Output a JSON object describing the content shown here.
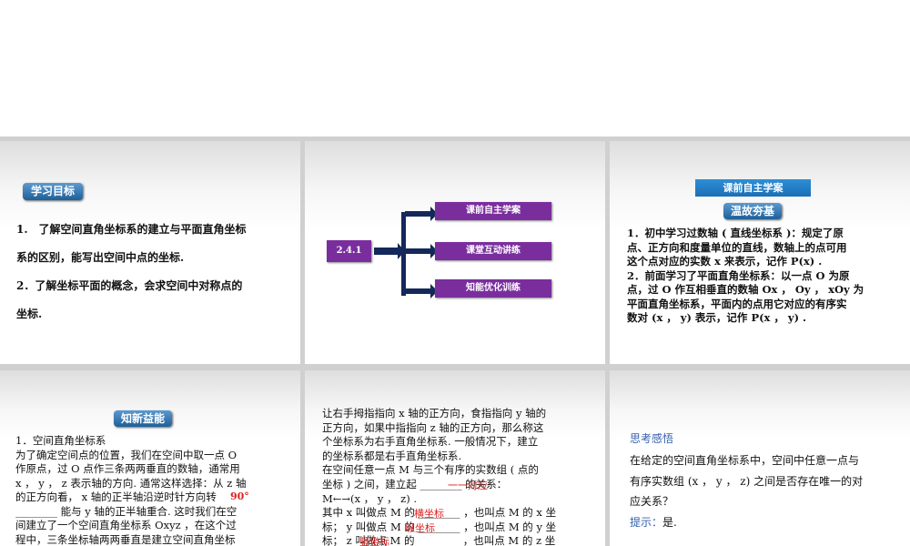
{
  "slide1": {
    "badge": "学习目标",
    "lines": [
      "1.　了解空间直角坐标系的建立与平面直角坐标",
      "系的区别，能写出空间中点的坐标.",
      "2．了解坐标平面的概念，会求空间中对称点的",
      "坐标."
    ]
  },
  "slide2": {
    "section": "2.4.1",
    "items": [
      "课前自主学案",
      "课堂互动讲练",
      "知能优化训练"
    ],
    "colors": {
      "box": "#7a2e9e",
      "arrow": "#14285a"
    }
  },
  "slide3": {
    "header": "课前自主学案",
    "badge": "温故夯基",
    "lines": [
      "1．初中学习过数轴 ( 直线坐标系 )：规定了原",
      "点、正方向和度量单位的直线，数轴上的点可用",
      "这个点对应的实数 x 来表示，记作 P(x) .",
      "2．前面学习了平面直角坐标系：以一点 O 为原",
      "点，过 O 作互相垂直的数轴 Ox ， Oy ， xOy 为",
      "平面直角坐标系，平面内的点用它对应的有序实",
      "数对 (x ， y) 表示，记作 P(x ， y) ."
    ]
  },
  "slide4": {
    "badge": "知新益能",
    "lines": [
      "1．空间直角坐标系",
      "为了确定空间点的位置，我们在空间中取一点 O",
      "作原点，过 O 点作三条两两垂直的数轴，通常用",
      "x ， y ， z 表示轴的方向. 通常这样选择：从 z 轴",
      "的正方向看， x 轴的正半轴沿逆时针方向转",
      "________ 能与 y 轴的正半轴重合. 这时我们在空",
      "间建立了一个空间直角坐标系 Oxyz ，在这个过",
      "程中，三条坐标轴两两垂直是建立空间直角坐标"
    ],
    "answer": "90°"
  },
  "slide5": {
    "lines": [
      "让右手拇指指向 x 轴的正方向，食指指向 y 轴的",
      "正方向，如果中指指向 z 轴的正方向，那么称这",
      "个坐标系为右手直角坐标系. 一般情况下，建立",
      "的坐标系都是右手直角坐标系.",
      "在空间任意一点 M 与三个有序的实数组 ( 点的",
      "坐标 ) 之间，建立起 ________ 的关系：",
      "M←→(x ， y ， z) .",
      "其中 x 叫做点 M 的 ________ ，也叫点 M 的 x 坐",
      "标； y 叫做点 M 的 ________ ，也叫点 M 的 y 坐",
      "标； z 叫做点 M 的 ________ ，也叫点 M 的 z 坐"
    ],
    "answers": [
      "一一对应",
      "横坐标",
      "纵坐标",
      "竖坐标"
    ]
  },
  "slide6": {
    "title": "思考感悟",
    "lines": [
      "在给定的空间直角坐标系中，空间中任意一点与",
      "有序实数组 (x ， y ， z) 之间是否存在唯一的对",
      "应关系？"
    ],
    "hint_label": "提示：",
    "hint": "是."
  }
}
